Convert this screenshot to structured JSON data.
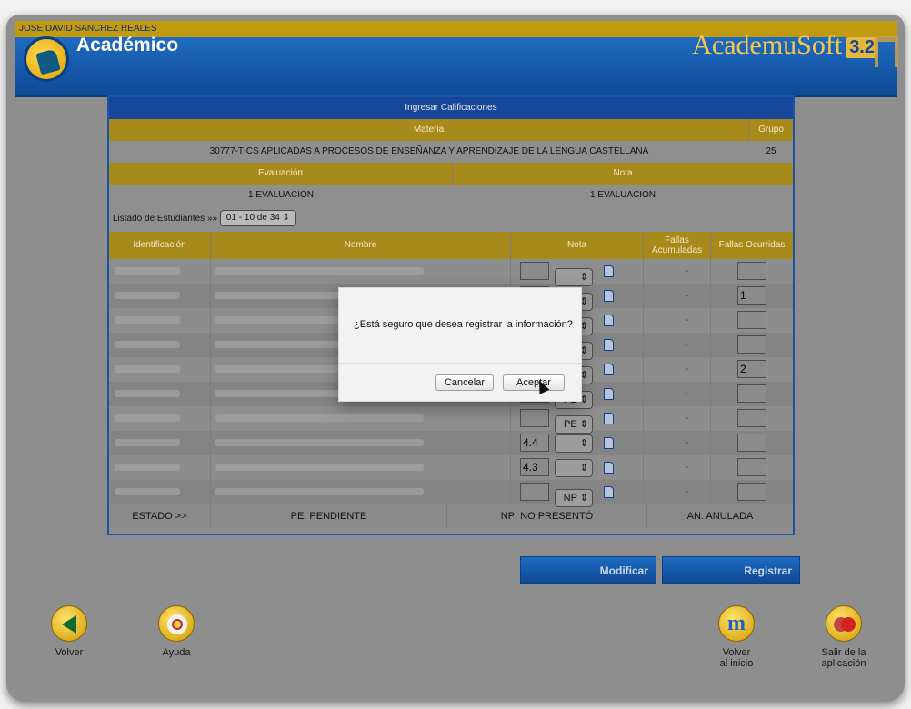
{
  "user": {
    "name": "JOSE DAVID SANCHEZ REALES"
  },
  "header": {
    "app_title": "Académico",
    "brand": "AcademuSoft",
    "version": "3.2"
  },
  "panel": {
    "title": "Ingresar Calificaciones",
    "materia_label": "Materia",
    "grupo_label": "Grupo",
    "materia_value": "30777-TICS APLICADAS A PROCESOS DE ENSEÑANZA Y APRENDIZAJE DE LA LENGUA CASTELLANA",
    "grupo_value": "25",
    "evaluacion_label": "Evaluación",
    "nota_label": "Nota",
    "evaluacion_value": "1 EVALUACION",
    "nota_value": "1 EVALUACION",
    "listado_label": "Listado de Estudiantes »»",
    "listado_selected": "01 - 10 de 34"
  },
  "table": {
    "headers": {
      "identificacion": "Identificación",
      "nombre": "Nombre",
      "nota": "Nota",
      "fallas_acumuladas": "Fallas Acumuladas",
      "fallas_ocurridas": "Fallas Ocurridas"
    },
    "rows": [
      {
        "id": "CC - 32602399",
        "name": "AFRICANO DE LA HOZ ...",
        "nota": "",
        "sel": "",
        "fa": "-",
        "fo": ""
      },
      {
        "id": "CC - 1048726901",
        "name": "AMADOR CAMACHO ...",
        "nota": "",
        "sel": "",
        "fa": "-",
        "fo": "1"
      },
      {
        "id": "CC - 1143249106",
        "name": "ARRIETA MOLINA JULIE ...",
        "nota": "",
        "sel": "",
        "fa": "-",
        "fo": ""
      },
      {
        "id": "CC - 1066049993",
        "name": "BARRIOS RODRIGUEZ ...",
        "nota": "",
        "sel": "",
        "fa": "-",
        "fo": ""
      },
      {
        "id": "CC - 32903277",
        "name": "BLANCO ORTEGA KARY ...",
        "nota": "",
        "sel": "",
        "fa": "-",
        "fo": "2"
      },
      {
        "id": "CC - 1129497133",
        "name": "BOLIVAR ARIZA JORGE LUIS",
        "nota": "",
        "sel": "PE",
        "fa": "-",
        "fo": ""
      },
      {
        "id": "CC - 1082977104",
        "name": "CANTILLO MARTINEZ KAREN YERINA",
        "nota": "",
        "sel": "PE",
        "fa": "-",
        "fo": ""
      },
      {
        "id": "CC - 1044422875",
        "name": "CERVANTES FISCHER ESTRELLA SOFIA",
        "nota": "4.4",
        "sel": "",
        "fa": "-",
        "fo": ""
      },
      {
        "id": "CC - 1143828072",
        "name": "COHEN BADILLO ANGELICA MARIA",
        "nota": "4.3",
        "sel": "",
        "fa": "-",
        "fo": ""
      },
      {
        "id": "CC - 1063081086",
        "name": "CORDERO ESPITIA KEYLA PATRICIA",
        "nota": "",
        "sel": "NP",
        "fa": "-",
        "fo": ""
      }
    ]
  },
  "status": {
    "estado": "ESTADO >>",
    "pe": "PE: PENDIENTE",
    "np": "NP: NO PRESENTÓ",
    "an": "AN: ANULADA"
  },
  "actions": {
    "modificar": "Modificar",
    "registrar": "Registrar"
  },
  "nav": {
    "volver": "Volver",
    "ayuda": "Ayuda",
    "volver_inicio_1": "Volver",
    "volver_inicio_2": "al inicio",
    "salir_1": "Salir de la",
    "salir_2": "aplicación"
  },
  "modal": {
    "message": "¿Está seguro que desea registrar la información?",
    "cancel": "Cancelar",
    "accept": "Aceptar"
  }
}
